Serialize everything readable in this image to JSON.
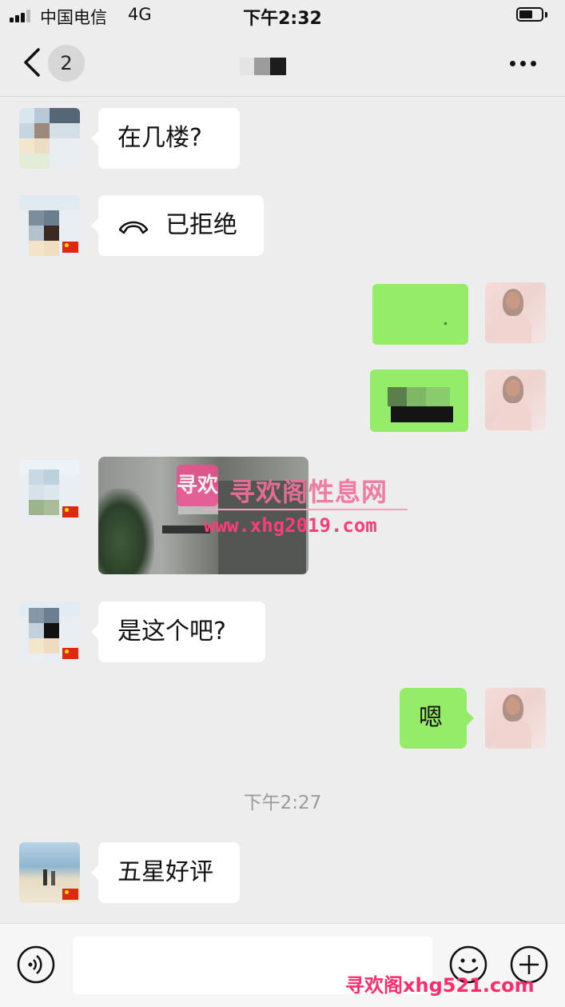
{
  "status_bar": {
    "carrier": "中国电信",
    "network": "4G",
    "time": "下午2:32"
  },
  "nav": {
    "unread_count": "2",
    "icons": [
      "back-chevron-icon",
      "more-dots-icon"
    ]
  },
  "messages": [
    {
      "side": "left",
      "type": "text",
      "text": "在几楼?"
    },
    {
      "side": "left",
      "type": "call",
      "text": "已拒绝",
      "icon": "hangup-phone-icon"
    },
    {
      "side": "right",
      "type": "obscured"
    },
    {
      "side": "right",
      "type": "obscured"
    },
    {
      "side": "left",
      "type": "image"
    },
    {
      "side": "left",
      "type": "text",
      "text": "是这个吧?"
    },
    {
      "side": "right",
      "type": "text",
      "text": "嗯"
    },
    {
      "type": "time",
      "text": "下午2:27"
    },
    {
      "side": "left",
      "type": "text",
      "text": "五星好评"
    }
  ],
  "watermarks": {
    "logo": "寻欢",
    "site_name": "寻欢阁性息网",
    "site_url": "www.xhg2019.com",
    "bottom": "寻欢阁xhg521.com"
  },
  "input_bar": {
    "value": "",
    "icons": [
      "voice-icon",
      "emoji-icon",
      "plus-icon"
    ]
  },
  "colors": {
    "background": "#ededed",
    "bubble_self": "#95ec69",
    "bubble_other": "#ffffff",
    "watermark": "#ff3d7a"
  }
}
